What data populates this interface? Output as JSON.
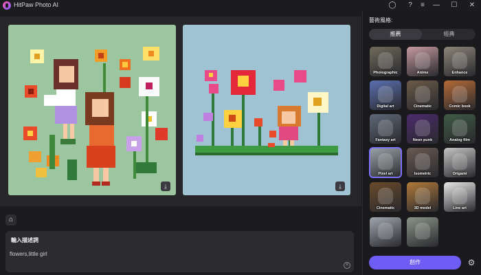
{
  "app": {
    "title": "HitPaw Photo AI"
  },
  "window": {
    "minimize_glyph": "—",
    "maximize_glyph": "☐",
    "close_glyph": "✕",
    "menu_glyph": "≡",
    "help_glyph": "?"
  },
  "prompt": {
    "title": "輸入描述詞",
    "value": "flowers,little girl"
  },
  "side": {
    "title": "藝術風格:",
    "tabs": [
      {
        "label": "推薦"
      },
      {
        "label": "經典"
      }
    ],
    "styles": [
      {
        "label": "Photographic",
        "bg": "#6f6a5a"
      },
      {
        "label": "Anime",
        "bg": "#c59aa0"
      },
      {
        "label": "Enhance",
        "bg": "#8c8478"
      },
      {
        "label": "Digital art",
        "bg": "#5a6fb0"
      },
      {
        "label": "Cinematic",
        "bg": "#6a5a48"
      },
      {
        "label": "Comic book",
        "bg": "#b46a38"
      },
      {
        "label": "Fantasy art",
        "bg": "#5e6878"
      },
      {
        "label": "Neon punk",
        "bg": "#4a2a6a"
      },
      {
        "label": "Analog film",
        "bg": "#3f5a45"
      },
      {
        "label": "Pixel art",
        "bg": "#9aa4a8"
      },
      {
        "label": "Isometric",
        "bg": "#6a5a52"
      },
      {
        "label": "Origami",
        "bg": "#c4c4c4"
      },
      {
        "label": "Cinematic",
        "bg": "#6a4a2a"
      },
      {
        "label": "3D model",
        "bg": "#b07a3a"
      },
      {
        "label": "Line art",
        "bg": "#e8e8e8"
      },
      {
        "label": "",
        "bg": "#a0a6ae"
      },
      {
        "label": "",
        "bg": "#8a9488"
      }
    ]
  },
  "actions": {
    "create_label": "創作"
  }
}
